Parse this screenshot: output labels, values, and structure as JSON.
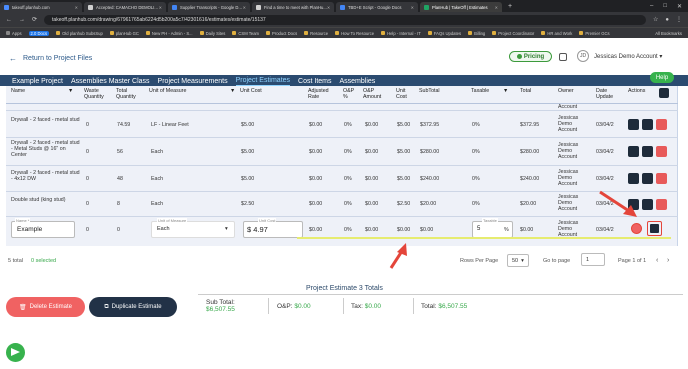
{
  "browser": {
    "tabs": [
      {
        "title": "takeoff.planhub.com",
        "fav": "#4a8cff"
      },
      {
        "title": "Accepted: CAMACHO DEMOLI...",
        "fav": "#d0d0d0"
      },
      {
        "title": "Supplier Transcripts - Google D...",
        "fav": "#4285f4"
      },
      {
        "title": "Find a time to meet with PlanHu...",
        "fav": "#d0d0d0"
      },
      {
        "title": "TBD+E Script - Google Docs",
        "fav": "#4285f4"
      },
      {
        "title": "PlanHub | TakeOff | Estimates",
        "fav": "#1fa463"
      }
    ],
    "url": "takeoff.planhub.com/drawing/67961765ab6224d5b200a5c7/42301616/estimates/estimate/15137",
    "bookmarks": [
      "Apps",
      "2.0 Docs",
      "Old planhub SubsSup",
      "planHub GC",
      "New PH - Admin - S...",
      "Daily Sites",
      "CSM Team",
      "Product Docs",
      "Resource",
      "How To Resource",
      "Help - Internal - IT",
      "FAQs Updates",
      "Billing",
      "Project Coordinator",
      "HR and Work",
      "Premier GCs"
    ],
    "all_bookmarks": "All Bookmarks"
  },
  "header": {
    "back_label": "Return to Project Files",
    "pricing_label": "Pricing",
    "avatar_initials": "JD",
    "account_name": "Jessicas Demo Account",
    "help_label": "Help"
  },
  "nav": [
    "Example Project",
    "Assemblies Master Class",
    "Project Measurements",
    "Project Estimates",
    "Cost Items",
    "Assemblies"
  ],
  "nav_active": "Project Estimates",
  "table": {
    "headers": [
      "Name",
      "Waste Quantity",
      "Total Quantity",
      "Unit of Measure",
      "Unit Cost",
      "Adjusted Rate",
      "O&P %",
      "O&P Amount",
      "Unit Cost",
      "SubTotal",
      "Taxable",
      "Total",
      "Owner",
      "Date Update",
      "Actions"
    ],
    "rows": [
      {
        "name": "Drywall - 2 faced - metal stud",
        "waste": "0",
        "qty": "74.59",
        "uom": "LF - Linear Feet",
        "unit_cost": "$5.00",
        "adj": "$0.00",
        "op": "0%",
        "op_amt": "$0.00",
        "uc": "$5.00",
        "subtotal": "$372.95",
        "taxable": "0%",
        "total": "$372.95",
        "owner": "Jessicas Demo Account",
        "date": "03/04/2"
      },
      {
        "name": "Drywall - 2 faced - metal stud - Metal Studs @ 16\" on Center",
        "waste": "0",
        "qty": "56",
        "uom": "Each",
        "unit_cost": "$5.00",
        "adj": "$0.00",
        "op": "0%",
        "op_amt": "$0.00",
        "uc": "$5.00",
        "subtotal": "$280.00",
        "taxable": "0%",
        "total": "$280.00",
        "owner": "Jessicas Demo Account",
        "date": "03/04/2"
      },
      {
        "name": "Drywall - 2 faced - metal stud - 4x12 DW",
        "waste": "0",
        "qty": "48",
        "uom": "Each",
        "unit_cost": "$5.00",
        "adj": "$0.00",
        "op": "0%",
        "op_amt": "$0.00",
        "uc": "$5.00",
        "subtotal": "$240.00",
        "taxable": "0%",
        "total": "$240.00",
        "owner": "Jessicas Demo Account",
        "date": "03/04/2"
      },
      {
        "name": "Double stud (king stud)",
        "waste": "0",
        "qty": "8",
        "uom": "Each",
        "unit_cost": "$2.50",
        "adj": "$0.00",
        "op": "0%",
        "op_amt": "$0.00",
        "uc": "$2.50",
        "subtotal": "$20.00",
        "taxable": "0%",
        "total": "$20.00",
        "owner": "Jessicas Demo Account",
        "date": "03/04/2"
      }
    ],
    "partial_top_owner": "Account",
    "edit_row": {
      "name_label": "Name *",
      "name_value": "Example",
      "waste": "0",
      "qty": "0",
      "uom_label": "Unit of Measure",
      "uom_value": "Each",
      "cost_label": "Unit Cost",
      "cost_value": "$ 4.97",
      "adj": "$0.00",
      "op": "0%",
      "op_amt": "$0.00",
      "uc": "$0.00",
      "subtotal": "$0.00",
      "taxable_label": "Taxable",
      "taxable_value": "5",
      "taxable_unit": "%",
      "total": "$0.00",
      "owner": "Jessicas Demo Account",
      "date": "03/04/2"
    }
  },
  "footer": {
    "total": "5 total",
    "selected": "0 selected",
    "rows_per_page_label": "Rows Per Page",
    "rows_per_page": "50",
    "go_to_page_label": "Go to page",
    "page": "1",
    "page_of": "Page 1 of 1"
  },
  "totals": {
    "title": "Project Estimate 3 Totals",
    "sub_label": "Sub Total:",
    "sub_value": "$6,507.55",
    "op_label": "O&P:",
    "op_value": "$0.00",
    "tax_label": "Tax:",
    "tax_value": "$0.00",
    "total_label": "Total:",
    "total_value": "$6,507.55"
  },
  "buttons": {
    "delete": "Delete Estimate",
    "duplicate": "Duplicate Estimate"
  },
  "colors": {
    "accent": "#2b4b70",
    "active_tab": "#8fd3ff",
    "green": "#37b24d",
    "red": "#f06262",
    "arrow": "#e4453a"
  }
}
